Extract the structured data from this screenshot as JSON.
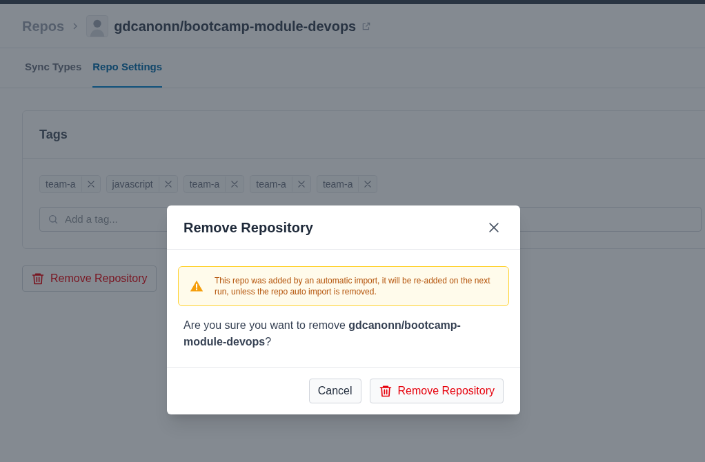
{
  "breadcrumb": {
    "root": "Repos",
    "repo": "gdcanonn/bootcamp-module-devops"
  },
  "tabs": [
    {
      "label": "Sync Types",
      "selected": false
    },
    {
      "label": "Repo Settings",
      "selected": true
    }
  ],
  "tags_card": {
    "title": "Tags",
    "tags": [
      "team-a",
      "javascript",
      "team-a",
      "team-a",
      "team-a"
    ],
    "input": {
      "placeholder": "Add a tag..."
    }
  },
  "remove_button": "Remove Repository",
  "dialog": {
    "title": "Remove Repository",
    "warning": "This repo was added by an automatic import, it will be re-added on the next run, unless the repo auto import is removed.",
    "message": "Are you sure you want to remove **gdcanonn/bootcamp-module-devops**?",
    "buttons": [
      {
        "label": "Cancel",
        "kind": "secondary"
      },
      {
        "label": "Remove Repository",
        "kind": "danger"
      }
    ]
  }
}
